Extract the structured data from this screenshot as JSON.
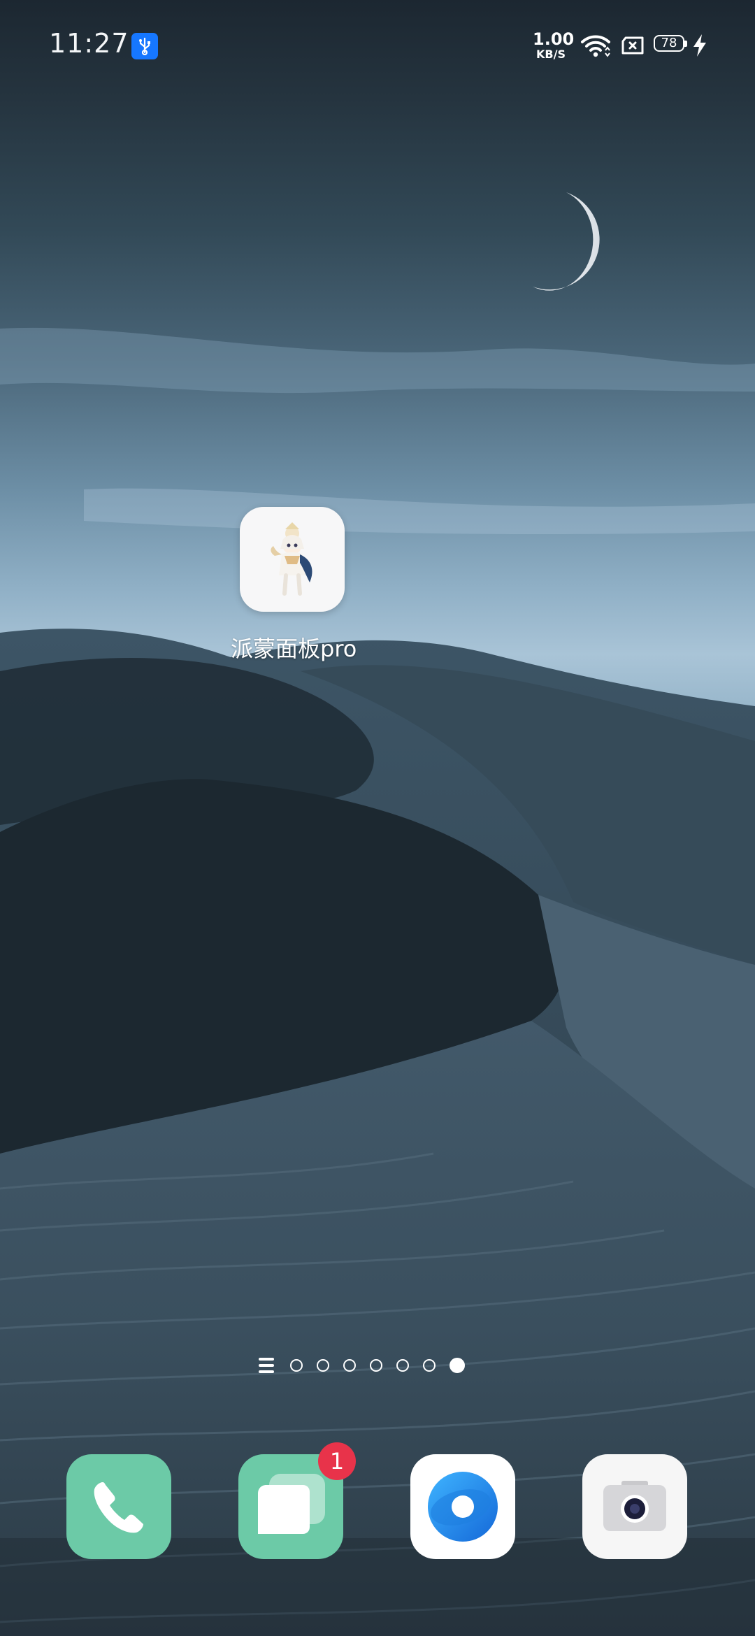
{
  "status_bar": {
    "time": "11:27",
    "network_speed_value": "1.00",
    "network_speed_unit": "KB/S",
    "battery_level": "78",
    "icons": [
      "usb-debugging-icon",
      "wifi-icon",
      "no-sim-icon",
      "battery-icon",
      "charging-icon"
    ]
  },
  "home": {
    "apps": [
      {
        "label": "派蒙面板pro",
        "icon": "paimon-app-icon"
      }
    ]
  },
  "page_indicator": {
    "page_count": 7,
    "active_page": 7
  },
  "dock": {
    "apps": [
      {
        "name": "phone",
        "icon": "phone-icon"
      },
      {
        "name": "messages",
        "icon": "messages-icon",
        "badge": "1"
      },
      {
        "name": "browser",
        "icon": "browser-icon"
      },
      {
        "name": "camera",
        "icon": "camera-icon"
      }
    ]
  },
  "colors": {
    "dock_green": "#6ccaa7",
    "badge_red": "#e8334a",
    "usb_blue": "#1677ff",
    "browser_blue": "#1f8ee8"
  }
}
